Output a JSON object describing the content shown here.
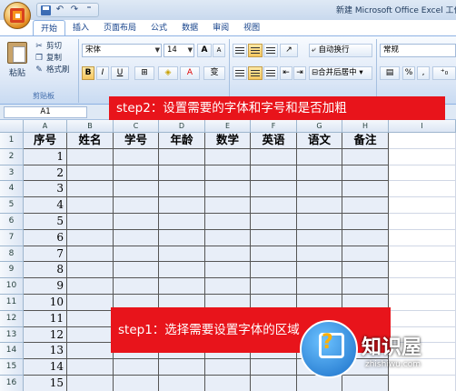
{
  "window": {
    "title": "新建 Microsoft Office Excel 工作"
  },
  "tabs": [
    "开始",
    "插入",
    "页面布局",
    "公式",
    "数据",
    "审阅",
    "视图"
  ],
  "ribbon": {
    "paste_label": "粘贴",
    "cut_label": "剪切",
    "copy_label": "复制",
    "format_painter_label": "格式刷",
    "clipboard_group": "剪贴板",
    "font_name": "宋体",
    "font_size": "14",
    "wrap_text": "自动换行",
    "merge_center": "合并后居中",
    "number_format": "常规",
    "bold": "B",
    "italic": "I",
    "underline": "U",
    "grow_font": "A",
    "shrink_font": "A",
    "percent": "%",
    "comma": ","
  },
  "name_box": "A1",
  "columns": [
    "A",
    "B",
    "C",
    "D",
    "E",
    "F",
    "G",
    "H",
    "I"
  ],
  "rows": [
    "1",
    "2",
    "3",
    "4",
    "5",
    "6",
    "7",
    "8",
    "9",
    "10",
    "11",
    "12",
    "13",
    "14",
    "15",
    "16"
  ],
  "table": {
    "headers": [
      "序号",
      "姓名",
      "学号",
      "年龄",
      "数学",
      "英语",
      "语文",
      "备注"
    ],
    "serials": [
      "1",
      "2",
      "3",
      "4",
      "5",
      "6",
      "7",
      "8",
      "9",
      "10",
      "11",
      "12",
      "13",
      "14",
      "15"
    ]
  },
  "callouts": {
    "step2": "step2：设置需要的字体和字号和是否加粗",
    "step1": "step1：选择需要设置字体的区域"
  },
  "watermark": {
    "brand": "知识屋",
    "url": "zhishiwu.com",
    "glyph": "?"
  },
  "colors": {
    "callout": "#e8141b",
    "header_bg": "#dce6f4",
    "selection": "#e8eef8"
  }
}
